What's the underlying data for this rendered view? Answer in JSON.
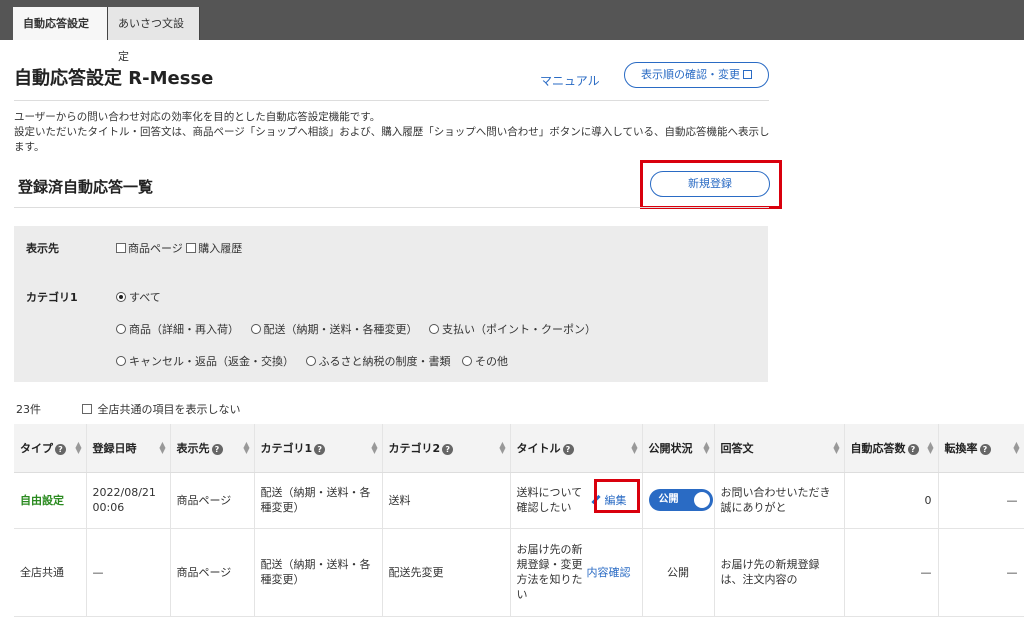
{
  "tabs": [
    {
      "label": "自動応答設定",
      "active": true
    },
    {
      "label": "あいさつ文設定",
      "active": false
    }
  ],
  "header": {
    "title": "自動応答設定 R-Messe",
    "manual_link": "マニュアル",
    "order_button": "表示順の確認・変更"
  },
  "description": {
    "line1": "ユーザーからの問い合わせ対応の効率化を目的とした自動応答設定機能です。",
    "line2": "設定いただいたタイトル・回答文は、商品ページ「ショップへ相談」および、購入履歴「ショップへ問い合わせ」ボタンに導入している、自動応答機能へ表示します。"
  },
  "section": {
    "title": "登録済自動応答一覧",
    "new_button": "新規登録"
  },
  "filters": {
    "display_label": "表示先",
    "display_options": [
      "商品ページ",
      "購入履歴"
    ],
    "category_label": "カテゴリ1",
    "category_options": [
      "すべて",
      "商品（詳細・再入荷）",
      "配送（納期・送料・各種変更）",
      "支払い（ポイント・クーポン）",
      "キャンセル・返品（返金・交換）",
      "ふるさと納税の制度・書類",
      "その他"
    ],
    "category_selected": "すべて"
  },
  "list": {
    "count": "23件",
    "hide_common_label": "全店共通の項目を表示しない"
  },
  "table": {
    "headers": {
      "type": "タイプ",
      "date": "登録日時",
      "display": "表示先",
      "cat1": "カテゴリ1",
      "cat2": "カテゴリ2",
      "title": "タイトル",
      "status": "公開状況",
      "answer": "回答文",
      "auto_count": "自動応答数",
      "rate": "転換率"
    },
    "rows": [
      {
        "type": "自由設定",
        "date": "2022/08/21 00:06",
        "display": "商品ページ",
        "cat1": "配送（納期・送料・各種変更）",
        "cat2": "送料",
        "title": "送料について確認したい",
        "action": "編集",
        "status": "公開",
        "answer": "お問い合わせいただき誠にありがと",
        "auto_count": "0",
        "rate": "—"
      },
      {
        "type": "全店共通",
        "date": "—",
        "display": "商品ページ",
        "cat1": "配送（納期・送料・各種変更）",
        "cat2": "配送先変更",
        "title": "お届け先の新規登録・変更方法を知りたい",
        "action": "内容確認",
        "status": "公開",
        "answer": "お届け先の新規登録は、注文内容の",
        "auto_count": "—",
        "rate": "—"
      }
    ]
  },
  "colors": {
    "accent": "#2a6bc4",
    "highlight": "#d9000d",
    "type_free": "#2a8a1f"
  }
}
